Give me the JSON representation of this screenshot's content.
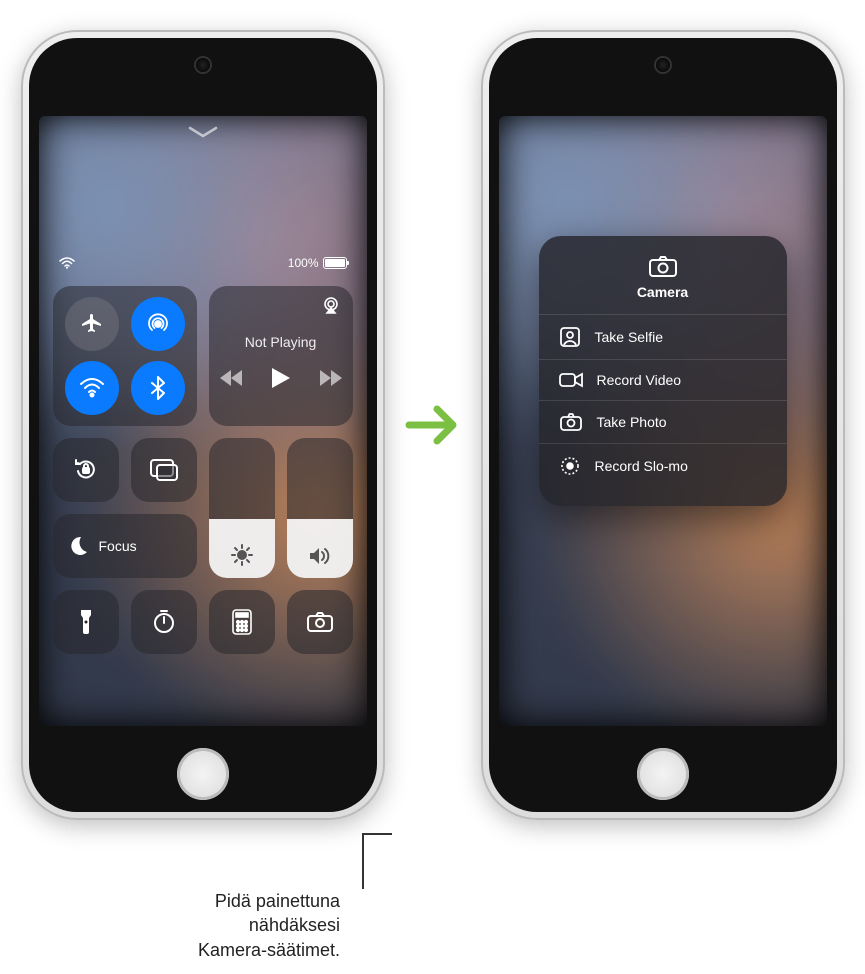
{
  "status": {
    "battery_text": "100%"
  },
  "connectivity": {
    "airplane": {
      "state": "off",
      "icon": "airplane-icon"
    },
    "airdrop": {
      "state": "on",
      "icon": "airdrop-icon"
    },
    "wifi": {
      "state": "on",
      "icon": "wifi-icon"
    },
    "bluetooth": {
      "state": "on",
      "icon": "bluetooth-icon"
    }
  },
  "music": {
    "status": "Not Playing"
  },
  "focus": {
    "label": "Focus"
  },
  "camera_menu": {
    "title": "Camera",
    "items": [
      {
        "label": "Take Selfie",
        "icon": "selfie-icon"
      },
      {
        "label": "Record Video",
        "icon": "video-icon"
      },
      {
        "label": "Take Photo",
        "icon": "camera-icon"
      },
      {
        "label": "Record Slo-mo",
        "icon": "slomo-icon"
      }
    ]
  },
  "callout": {
    "line1": "Pidä painettuna",
    "line2": "nähdäksesi",
    "line3": "Kamera-säätimet."
  }
}
